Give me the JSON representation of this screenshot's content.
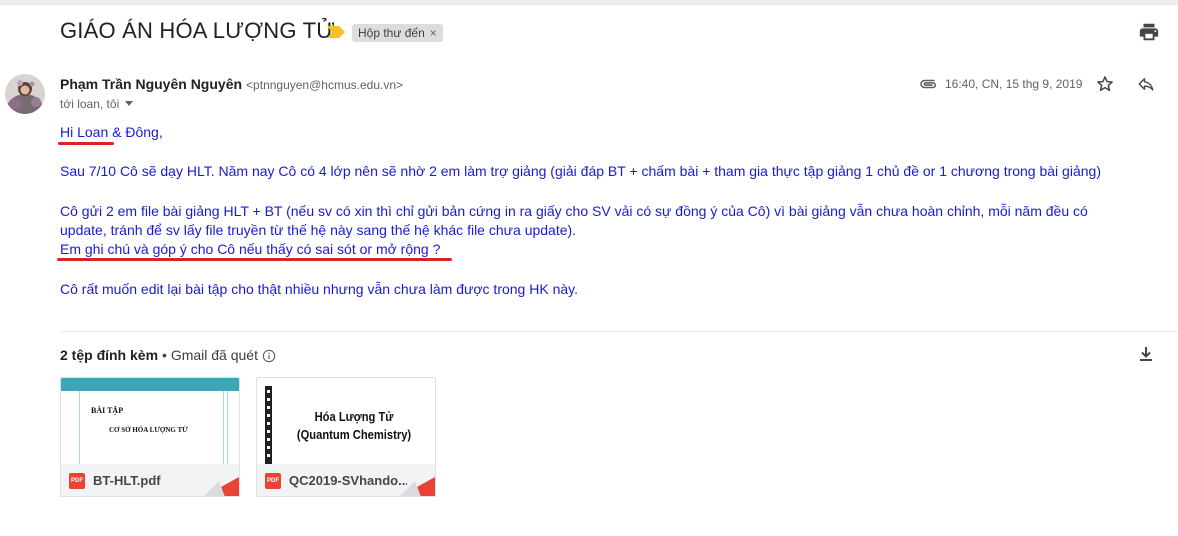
{
  "email": {
    "subject": "GIÁO ÁN HÓA LƯỢNG TỬ",
    "label": "Hộp thư đến",
    "label_close": "×",
    "importance_color": "#f6bf26",
    "sender": {
      "name": "Phạm Trần Nguyên Nguyên",
      "email": "<ptnnguyen@hcmus.edu.vn>",
      "recipients": "tới loan, tôi"
    },
    "date": "16:40, CN, 15 thg 9, 2019",
    "body": {
      "greeting": "Hi Loan & Đông,",
      "p1": "Sau 7/10 Cô sẽ dạy HLT. Năm nay Cô có 4 lớp nên sẽ nhờ 2 em làm trợ giảng (giải đáp BT + chấm bài + tham gia thực tập giảng 1 chủ đề or 1 chương  trong bài giảng)",
      "p2_line1": "Cô gửi 2 em file bài giảng HLT + BT (nếu sv có xin thì chỉ gửi bản cứng in ra giấy cho SV vải có sự đồng ý của Cô) vì bài giảng vẫn chưa hoàn chỉnh, mỗi năm đều có",
      "p2_line2": "update, tránh để sv lấy file truyền từ  thế hệ này sang thế hệ khác file chưa update).",
      "p2_line3": "Em ghi chú và góp ý cho Cô nếu thấy có sai sót or mở rộng ?",
      "p3": "Cô rất muốn edit lại bài tập cho thật nhiều nhưng vẫn chưa làm được trong HK này.",
      "text_color": "#1a1ad6",
      "highlight_color": "#d8232a"
    },
    "attachments": {
      "count_label": "2 tệp đính kèm",
      "scan_label": "• Gmail đã quét",
      "files": [
        {
          "name": "BT-HLT.pdf",
          "type_badge": "PDF",
          "preview_line1": "BÀI TẬP",
          "preview_line2": "CƠ SỞ HÓA LƯỢNG TỬ"
        },
        {
          "name": "QC2019-SVhando...",
          "type_badge": "PDF",
          "preview_line1": "Hóa Lượng Tử",
          "preview_line2": "(Quantum Chemistry)"
        }
      ]
    }
  },
  "icons": {
    "print": "printer-icon",
    "star": "star-icon",
    "reply": "reply-icon",
    "attachment": "paperclip-icon",
    "download": "download-icon",
    "info": "info-icon"
  }
}
